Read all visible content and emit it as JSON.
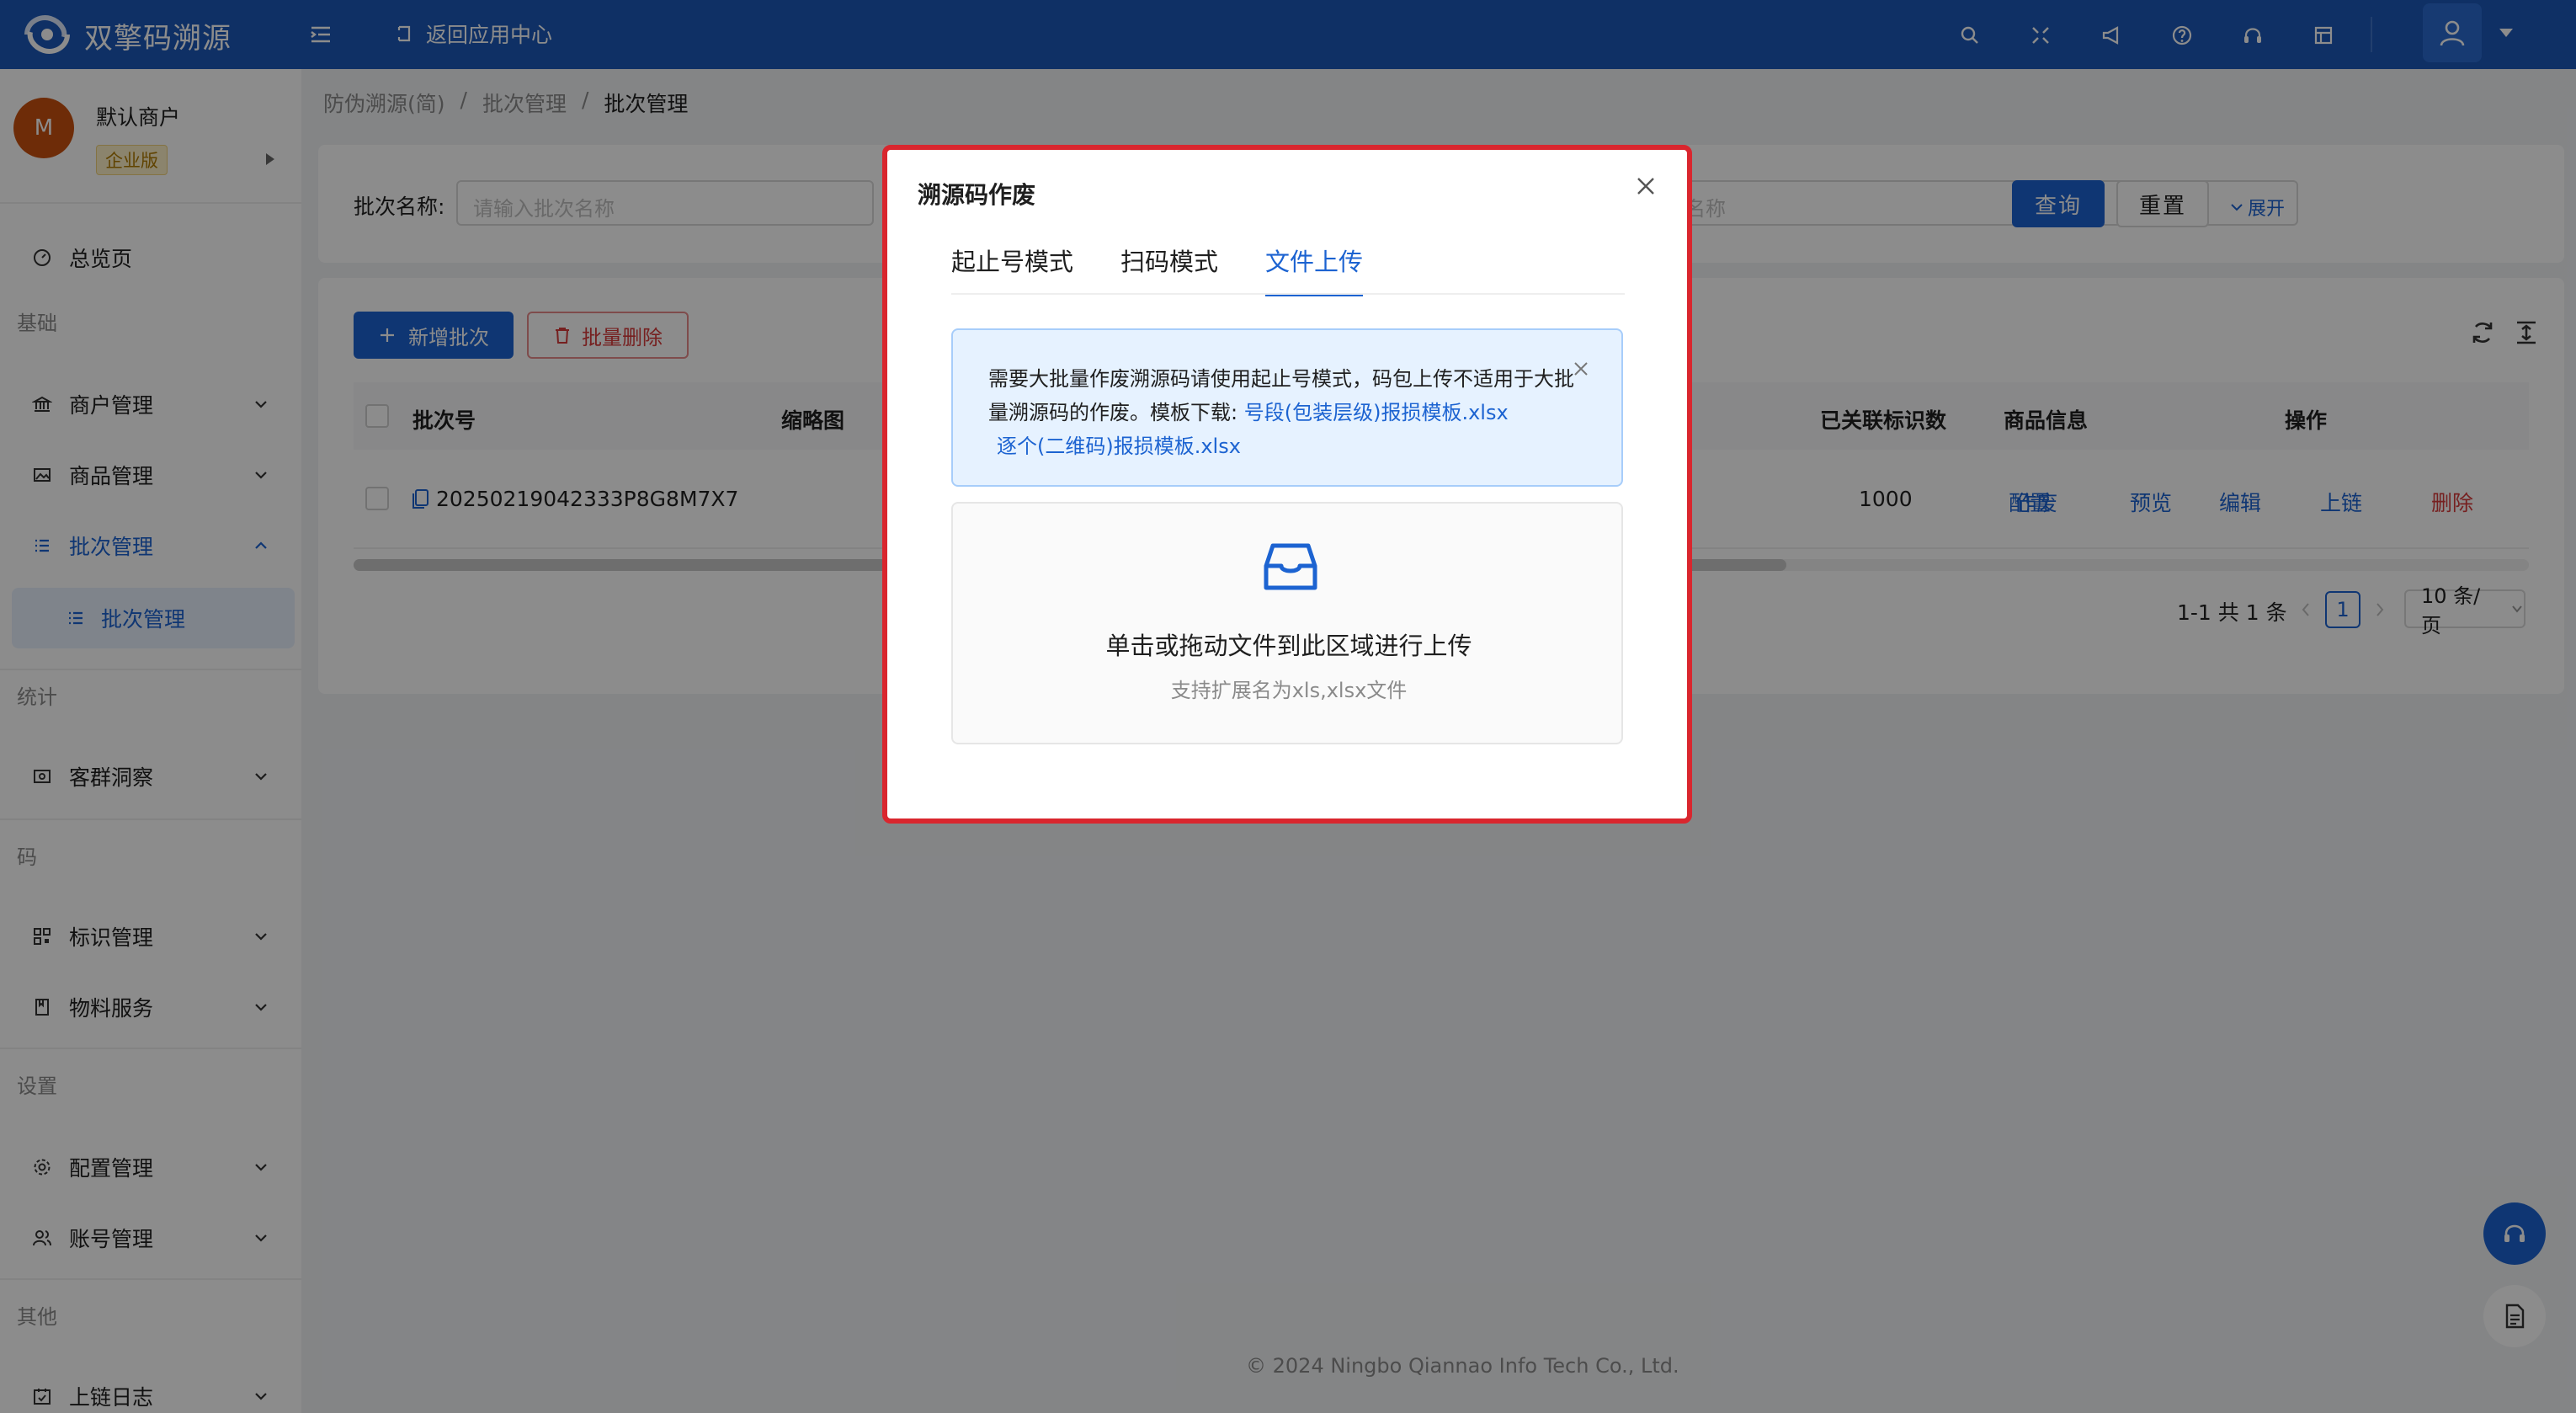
{
  "app": {
    "brand": "双擎码溯源",
    "back_label": "返回应用中心"
  },
  "merchant": {
    "avatar_letter": "M",
    "name": "默认商户",
    "badge": "企业版"
  },
  "sidebar": {
    "overview": "总览页",
    "sections": {
      "basic": "基础",
      "stats": "统计",
      "code": "码",
      "settings": "设置",
      "other": "其他"
    },
    "items": {
      "merchant_mgmt": "商户管理",
      "product_mgmt": "商品管理",
      "batch_mgmt": "批次管理",
      "batch_mgmt_sub": "批次管理",
      "customer_insight": "客群洞察",
      "id_mgmt": "标识管理",
      "material_service": "物料服务",
      "config_mgmt": "配置管理",
      "account_mgmt": "账号管理",
      "chain_log": "上链日志"
    }
  },
  "breadcrumb": {
    "level1": "防伪溯源(简)",
    "sep": "/",
    "level2": "批次管理",
    "level3": "批次管理"
  },
  "search": {
    "batch_label": "批次名称:",
    "batch_placeholder": "请输入批次名称",
    "second_placeholder": "名称",
    "query_label": "查询",
    "reset_label": "重置",
    "expand_label": "展开"
  },
  "table": {
    "add_label": "新增批次",
    "delete_label": "批量删除",
    "headers": {
      "batch_no": "批次号",
      "thumb": "缩略图",
      "linked_count": "已关联标识数",
      "product_info": "商品信息",
      "actions": "操作"
    },
    "rows": [
      {
        "batch_no": "20250219042333P8G8M7X7",
        "void_action": "作废",
        "linked_count": "1000",
        "config_action": "配置",
        "preview": "预览",
        "edit": "编辑",
        "chain": "上链",
        "delete": "删除"
      }
    ],
    "pagination": {
      "summary": "1-1 共 1 条",
      "current_page": "1",
      "page_size": "10 条/页"
    }
  },
  "footer": "© 2024 Ningbo Qiannao Info Tech Co., Ltd.",
  "modal": {
    "title": "溯源码作废",
    "tabs": [
      "起止号模式",
      "扫码模式",
      "文件上传"
    ],
    "active_tab": 2,
    "alert": {
      "text": "需要大批量作废溯源码请使用起止号模式，码包上传不适用于大批量溯源码的作废。模板下载: ",
      "link1": "号段(包装层级)报损模板.xlsx",
      "link2": "逐个(二维码)报损模板.xlsx"
    },
    "upload": {
      "title": "单击或拖动文件到此区域进行上传",
      "hint": "支持扩展名为xls,xlsx文件"
    }
  },
  "colors": {
    "primary": "#1c63d1",
    "topbar": "#1c58b8",
    "danger": "#d83b3b",
    "highlight": "#d9262e"
  }
}
